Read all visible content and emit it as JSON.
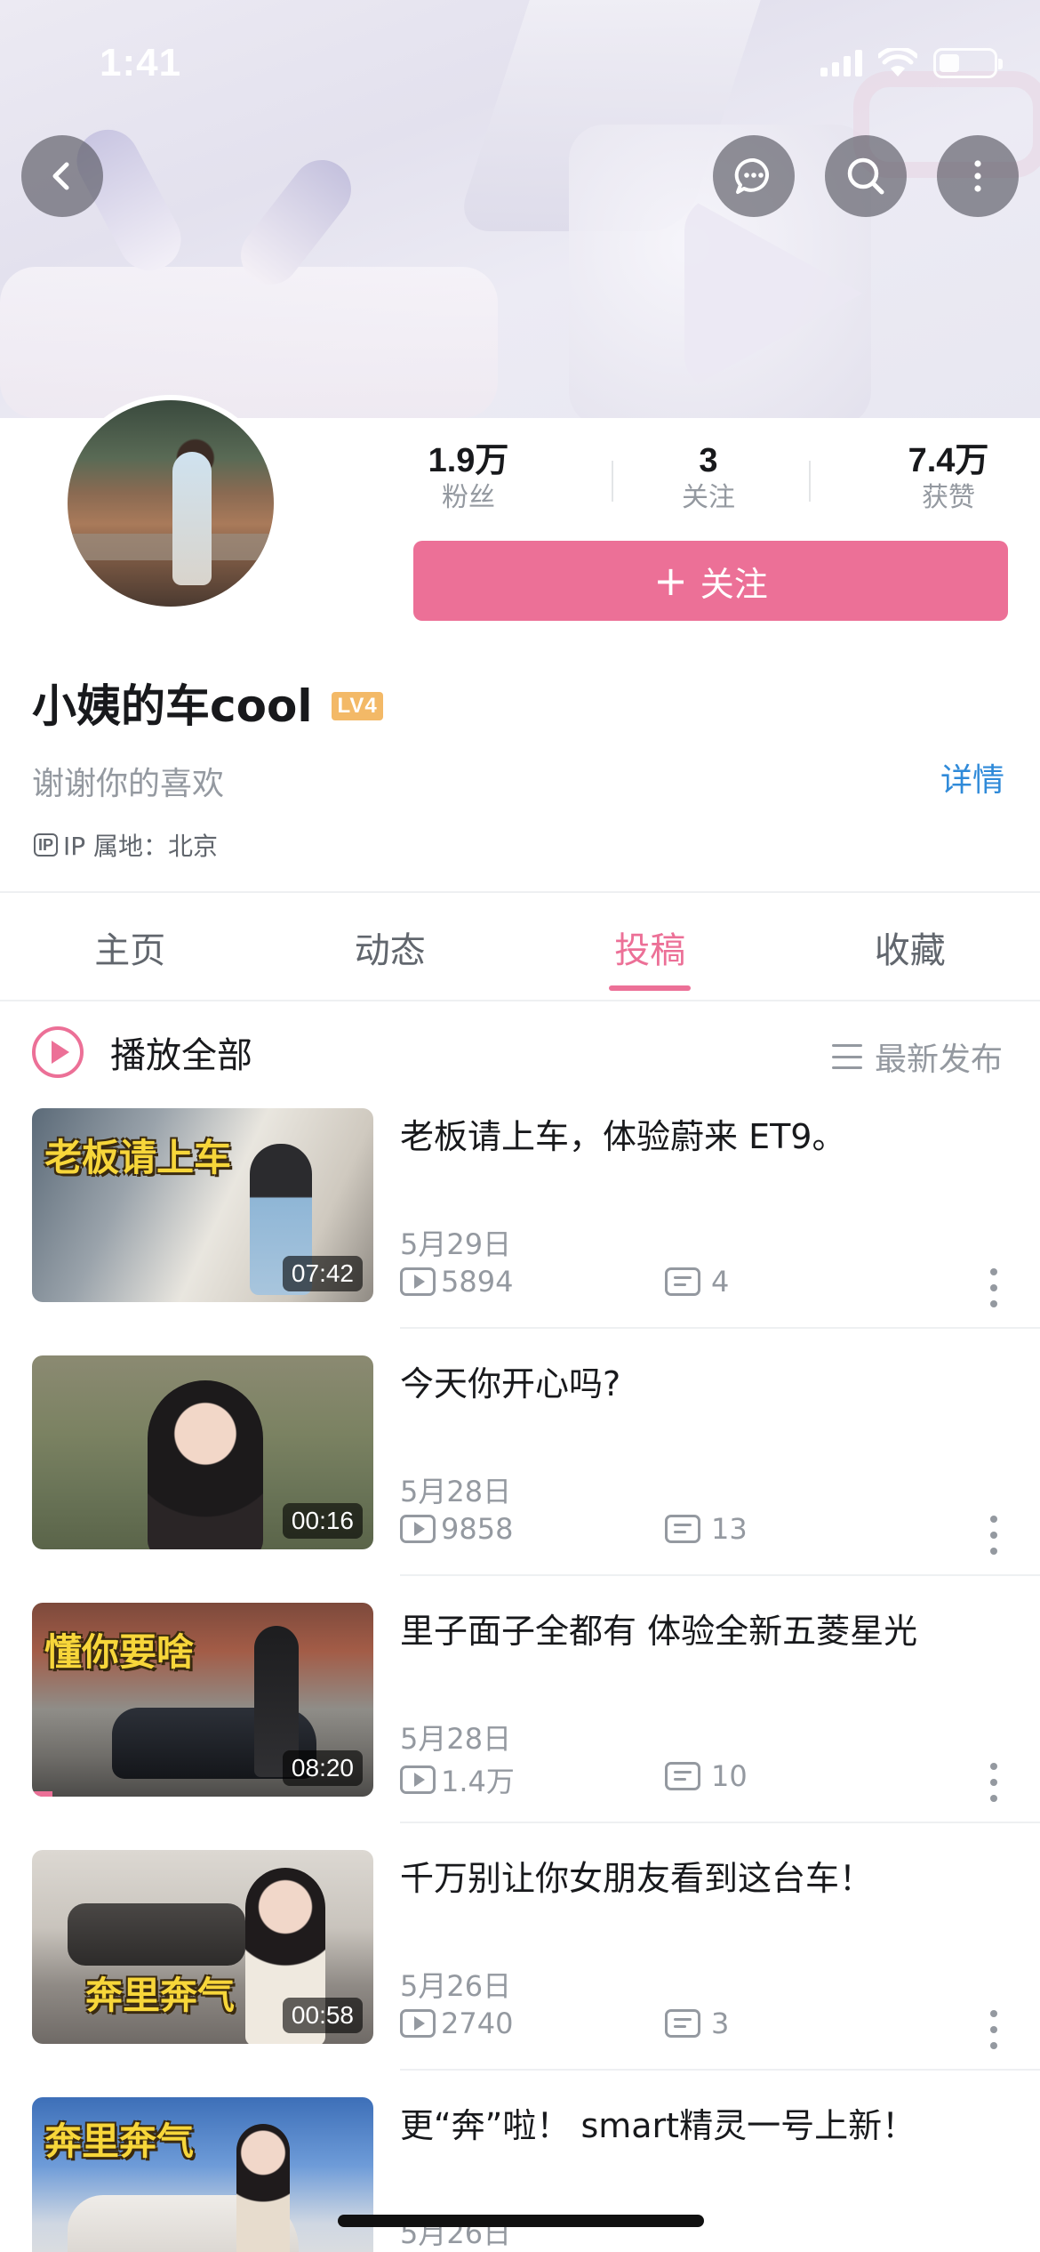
{
  "status_bar": {
    "time": "1:41"
  },
  "header": {
    "back_icon": "chevron-left-icon",
    "message_icon": "chat-bubble-icon",
    "search_icon": "search-icon",
    "more_icon": "vertical-dots-icon"
  },
  "profile": {
    "stats": [
      {
        "value": "1.9万",
        "label": "粉丝"
      },
      {
        "value": "3",
        "label": "关注"
      },
      {
        "value": "7.4万",
        "label": "获赞"
      }
    ],
    "follow_button": {
      "plus": "+",
      "label": "关注"
    },
    "name": "小姨的车cool",
    "level": "LV4",
    "signature": "谢谢你的喜欢",
    "detail_link": "详情",
    "ip_icon": "IP",
    "ip_location": "IP 属地：北京"
  },
  "tabs": [
    {
      "label": "主页",
      "active": false
    },
    {
      "label": "动态",
      "active": false
    },
    {
      "label": "投稿",
      "active": true
    },
    {
      "label": "收藏",
      "active": false
    }
  ],
  "list_header": {
    "play_all": "播放全部",
    "sort": "最新发布"
  },
  "videos": [
    {
      "title": "老板请上车，体验蔚来 ET9。",
      "overlay": "老板请上车",
      "duration": "07:42",
      "date": "5月29日",
      "plays": "5894",
      "comments": "4"
    },
    {
      "title": "今天你开心吗?",
      "overlay": "",
      "duration": "00:16",
      "date": "5月28日",
      "plays": "9858",
      "comments": "13"
    },
    {
      "title": "里子面子全都有 体验全新五菱星光",
      "overlay": "懂你要啥",
      "duration": "08:20",
      "date": "5月28日",
      "plays": "1.4万",
      "comments": "10",
      "watched_progress": 0.06
    },
    {
      "title": "千万别让你女朋友看到这台车！",
      "overlay": "奔里奔气",
      "duration": "00:58",
      "date": "5月26日",
      "plays": "2740",
      "comments": "3"
    },
    {
      "title": "更“奔”啦！ smart精灵一号上新！",
      "overlay": "奔里奔气",
      "duration": "",
      "date": "5月26日",
      "plays": "",
      "comments": ""
    }
  ],
  "colors": {
    "accent": "#ec7097",
    "link": "#2f8ad9",
    "level_badge": "#f3b967"
  }
}
